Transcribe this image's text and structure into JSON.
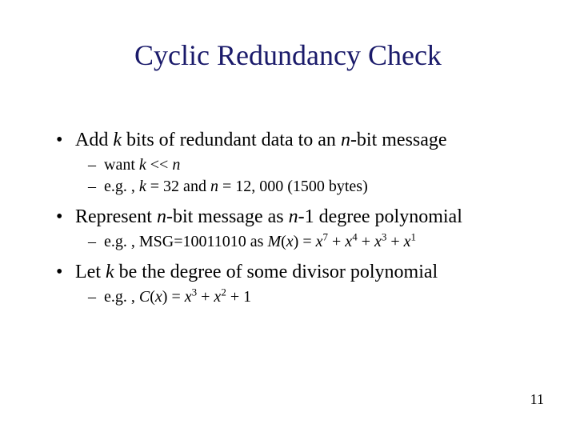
{
  "title": "Cyclic Redundancy Check",
  "bullets": {
    "b1a_pre": "Add ",
    "b1a_k": "k",
    "b1a_mid": " bits of redundant data to an ",
    "b1a_n": "n",
    "b1a_post": "-bit message",
    "b1a_s1_pre": "want ",
    "b1a_s1_k": "k",
    "b1a_s1_op": " << ",
    "b1a_s1_n": "n",
    "b1a_s2_pre": "e.g. , ",
    "b1a_s2_k": "k",
    "b1a_s2_keq": " = 32 and ",
    "b1a_s2_n": "n",
    "b1a_s2_post": " = 12, 000 (1500 bytes)",
    "b2a_pre": "Represent ",
    "b2a_n1": "n",
    "b2a_mid": "-bit message as ",
    "b2a_n2": "n",
    "b2a_post": "-1 degree polynomial",
    "b2a_s1_pre": "e.g. , MSG=10011010 as ",
    "b2a_s1_M": "M",
    "b2a_s1_paren": "(",
    "b2a_s1_x0": "x",
    "b2a_s1_eq": ") = ",
    "b2a_s1_x1": "x",
    "b2a_s1_e1": "7",
    "b2a_s1_p1": " + ",
    "b2a_s1_x2": "x",
    "b2a_s1_e2": "4",
    "b2a_s1_p2": " + ",
    "b2a_s1_x3": "x",
    "b2a_s1_e3": "3",
    "b2a_s1_p3": " + ",
    "b2a_s1_x4": "x",
    "b2a_s1_e4": "1",
    "b3a_pre": "Let ",
    "b3a_k": "k",
    "b3a_post": " be the degree of some divisor polynomial",
    "b3a_s1_pre": "e.g. , ",
    "b3a_s1_C": "C",
    "b3a_s1_paren": "(",
    "b3a_s1_x0": "x",
    "b3a_s1_eq": ") = ",
    "b3a_s1_x1": "x",
    "b3a_s1_e1": "3",
    "b3a_s1_p1": " + ",
    "b3a_s1_x2": "x",
    "b3a_s1_e2": "2",
    "b3a_s1_p2": " + 1"
  },
  "pagenum": "11"
}
